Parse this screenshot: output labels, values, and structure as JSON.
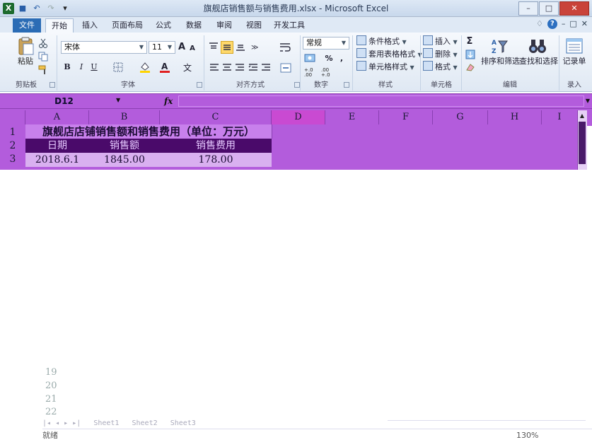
{
  "window": {
    "title": "旗舰店销售额与销售费用.xlsx - Microsoft Excel",
    "controls": {
      "minimize": "–",
      "maximize": "□",
      "close": "✕"
    }
  },
  "quick_access": {
    "logo": "X",
    "save": "■",
    "undo": "↶",
    "redo": "↷",
    "customize": "▾"
  },
  "ribbon_tabs": [
    "文件",
    "开始",
    "插入",
    "页面布局",
    "公式",
    "数据",
    "审阅",
    "视图",
    "开发工具"
  ],
  "ribbon_active_tab": "开始",
  "ribbon_right": {
    "collapse": "♢",
    "help": "?",
    "min": "–",
    "restore": "□",
    "close": "✕"
  },
  "clipboard": {
    "paste_label": "粘贴",
    "group_label": "剪贴板"
  },
  "font": {
    "font_name": "宋体",
    "font_size": "11",
    "grow": "A",
    "shrink": "A",
    "bold": "B",
    "italic": "I",
    "underline": "U",
    "group_label": "字体"
  },
  "alignment": {
    "group_label": "对齐方式"
  },
  "number": {
    "format": "常规",
    "percent": "%",
    "comma": ",",
    "inc_decimal": "+.0 .00",
    "dec_decimal": ".00 +.0",
    "group_label": "数字"
  },
  "styles": {
    "items": [
      "条件格式",
      "套用表格格式",
      "单元格样式"
    ],
    "group_label": "样式"
  },
  "cells": {
    "items": [
      "插入",
      "删除",
      "格式"
    ],
    "group_label": "单元格"
  },
  "editing": {
    "sigma": "Σ",
    "sort_filter": "排序和筛选",
    "find_select": "查找和选择",
    "group_label": "编辑"
  },
  "record": {
    "label": "记录单",
    "group_label": "录入"
  },
  "formula_bar": {
    "name_box": "D12",
    "fx": "fx"
  },
  "columns": [
    "A",
    "B",
    "C",
    "D",
    "E",
    "F",
    "G",
    "H",
    "I"
  ],
  "rows_visible": [
    "1",
    "2",
    "3"
  ],
  "rows_bottom": [
    "19",
    "20",
    "21",
    "22"
  ],
  "sheet": {
    "title_row": "旗舰店店铺销售额和销售费用（单位：万元）",
    "headers": [
      "日期",
      "销售额",
      "销售费用"
    ],
    "row3": [
      "2018.6.1",
      "1845.00",
      "178.00"
    ]
  },
  "sheet_tabs": [
    "Sheet1",
    "Sheet2",
    "Sheet3"
  ],
  "statusbar": {
    "ready": "就绪",
    "zoom": "130%"
  },
  "colors": {
    "purple_band": "#b35cdc",
    "header_fill": "#4a0a6a",
    "title_fill": "#c880ec",
    "selected_col": "#c94ad2"
  }
}
